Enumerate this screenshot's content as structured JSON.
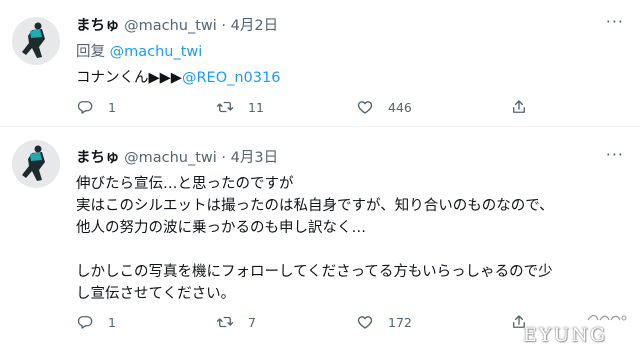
{
  "tweets": [
    {
      "author_name": "まちゅ",
      "handle": "@machu_twi",
      "separator": "·",
      "date": "4月2日",
      "reply_prefix": "回复",
      "reply_to": "@machu_twi",
      "body_text": "コナンくん▶▶▶",
      "body_mention": "@REO_n0316",
      "counts": {
        "reply": "1",
        "retweet": "11",
        "like": "446"
      }
    },
    {
      "author_name": "まちゅ",
      "handle": "@machu_twi",
      "separator": "·",
      "date": "4月3日",
      "lines": [
        "伸びたら宣伝…と思ったのですが",
        "実はこのシルエットは撮ったのは私自身ですが、知り合いのものなので、",
        "他人の努力の波に乗っかるのも申し訳なく…",
        "",
        "しかしこの写真を機にフォローしてくださってる方もいらっしゃるので少",
        "し宣伝させてください。"
      ],
      "counts": {
        "reply": "1",
        "retweet": "7",
        "like": "172"
      }
    }
  ],
  "more_glyph": "···",
  "watermark": {
    "text": "EYUNG"
  },
  "icons": {
    "reply": "reply-icon",
    "retweet": "retweet-icon",
    "like": "heart-icon",
    "share": "share-icon",
    "more": "more-icon"
  },
  "colors": {
    "link": "#1d9bf0",
    "muted": "#536471",
    "text": "#0f1419",
    "avatar_figure": "#22a9b4"
  }
}
